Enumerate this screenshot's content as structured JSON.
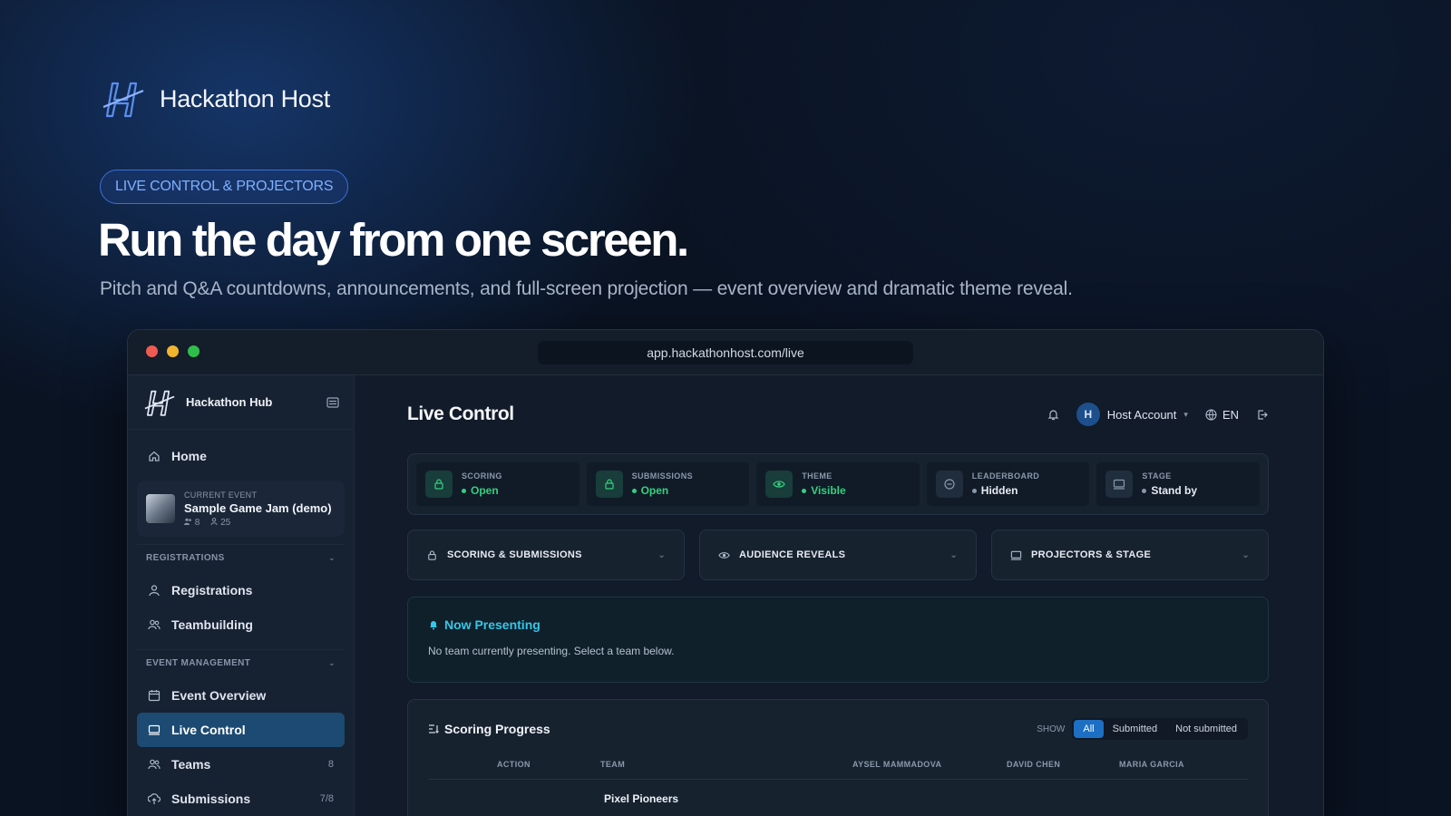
{
  "hero": {
    "brand": "Hackathon Host",
    "pill": "LIVE CONTROL & PROJECTORS",
    "headline": "Run the day from one screen.",
    "subline": "Pitch and Q&A countdowns, announcements, and full-screen projection — event overview and dramatic theme reveal."
  },
  "window": {
    "url": "app.hackathonhost.com/live",
    "dots": [
      "#ee5b52",
      "#f2b52f",
      "#2ebf4a"
    ]
  },
  "sidebar": {
    "title": "Hackathon Hub",
    "home": "Home",
    "current_event": {
      "label": "CURRENT EVENT",
      "name": "Sample Game Jam (demo)",
      "teams": "8",
      "members": "25"
    },
    "sections": [
      {
        "label": "REGISTRATIONS",
        "items": [
          {
            "label": "Registrations",
            "icon": "user-icon"
          },
          {
            "label": "Teambuilding",
            "icon": "users-icon"
          }
        ]
      },
      {
        "label": "EVENT MANAGEMENT",
        "items": [
          {
            "label": "Event Overview",
            "icon": "calendar-icon"
          },
          {
            "label": "Live Control",
            "icon": "monitor-icon",
            "active": true
          },
          {
            "label": "Teams",
            "icon": "users-icon",
            "count": "8"
          },
          {
            "label": "Submissions",
            "icon": "upload-icon",
            "count": "7/8"
          }
        ]
      }
    ]
  },
  "header": {
    "title": "Live Control",
    "account": "Host Account",
    "avatar": "H",
    "lang": "EN"
  },
  "status": [
    {
      "label": "SCORING",
      "value": "Open",
      "color": "#35d07f",
      "icon": "lock-icon",
      "on": true
    },
    {
      "label": "SUBMISSIONS",
      "value": "Open",
      "color": "#35d07f",
      "icon": "lock-icon",
      "on": true
    },
    {
      "label": "THEME",
      "value": "Visible",
      "color": "#35d07f",
      "icon": "eye-icon",
      "on": true
    },
    {
      "label": "LEADERBOARD",
      "value": "Hidden",
      "color": "#8a98aa",
      "icon": "minus-circle-icon",
      "on": false
    },
    {
      "label": "STAGE",
      "value": "Stand by",
      "color": "#8a98aa",
      "icon": "monitor-icon",
      "on": false
    }
  ],
  "panels": [
    {
      "label": "SCORING & SUBMISSIONS",
      "icon": "lock-icon"
    },
    {
      "label": "AUDIENCE REVEALS",
      "icon": "eye-icon"
    },
    {
      "label": "PROJECTORS & STAGE",
      "icon": "monitor-icon"
    }
  ],
  "presenting": {
    "title": "Now Presenting",
    "text": "No team currently presenting. Select a team below."
  },
  "scoring": {
    "title": "Scoring Progress",
    "show_label": "SHOW",
    "filters": [
      "All",
      "Submitted",
      "Not submitted"
    ],
    "columns": [
      "ACTION",
      "TEAM",
      "AYSEL MAMMADOVA",
      "DAVID CHEN",
      "MARIA GARCIA"
    ],
    "rows": [
      {
        "team": "Pixel Pioneers"
      }
    ]
  }
}
